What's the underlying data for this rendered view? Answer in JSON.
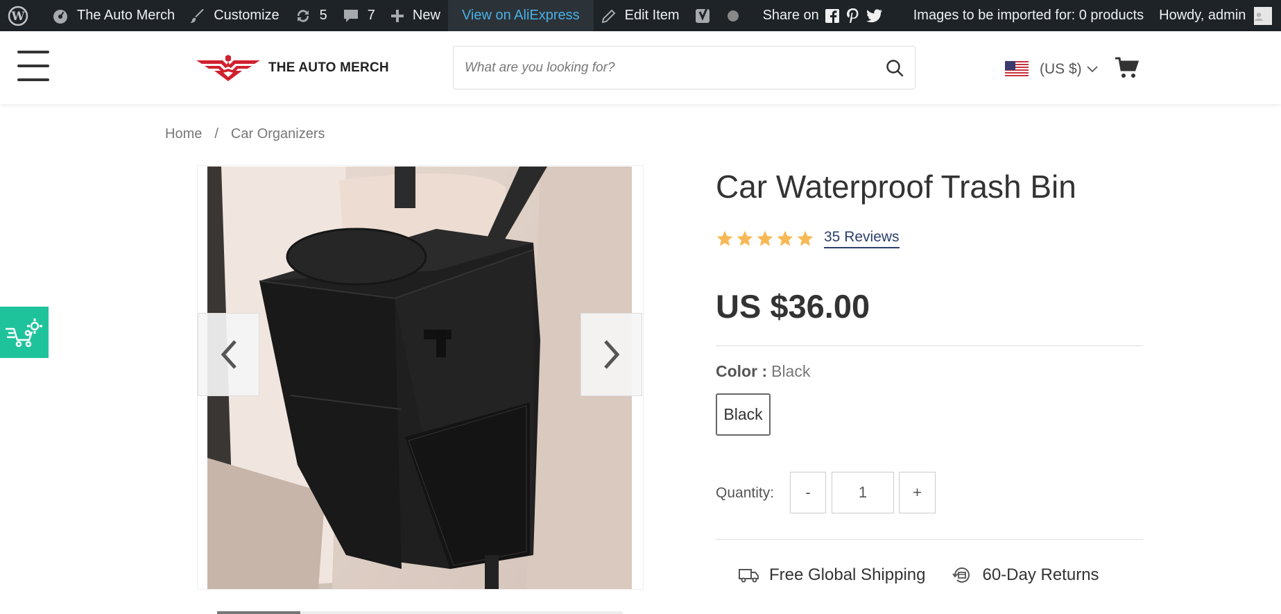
{
  "adminbar": {
    "site_name": "The Auto Merch",
    "customize": "Customize",
    "updates_count": "5",
    "comments_count": "7",
    "new_label": "New",
    "view_aliexpress": "View on AliExpress",
    "edit_item": "Edit Item",
    "share_on": "Share on",
    "import_status": "Images to be imported for: 0 products",
    "howdy": "Howdy, admin"
  },
  "header": {
    "logo_text": "THE AUTO MERCH",
    "search_placeholder": "What are you looking for?",
    "currency": "(US $)"
  },
  "breadcrumb": {
    "home": "Home",
    "separator": "/",
    "category": "Car Organizers"
  },
  "product": {
    "title": "Car Waterproof Trash Bin",
    "rating": 5,
    "reviews": "35 Reviews",
    "price": "US $36.00",
    "color_label": "Color :",
    "color_value": "Black",
    "swatch": "Black",
    "quantity_label": "Quantity:",
    "qty_minus": "-",
    "qty_value": "1",
    "qty_plus": "+",
    "feature_shipping": "Free Global Shipping",
    "feature_returns": "60-Day Returns"
  },
  "colors": {
    "adminbar_bg": "#1d2327",
    "accent_link": "#4ab0e6",
    "star": "#f7b955",
    "widget_green": "#1fc39b",
    "logo_red": "#d0202e"
  }
}
